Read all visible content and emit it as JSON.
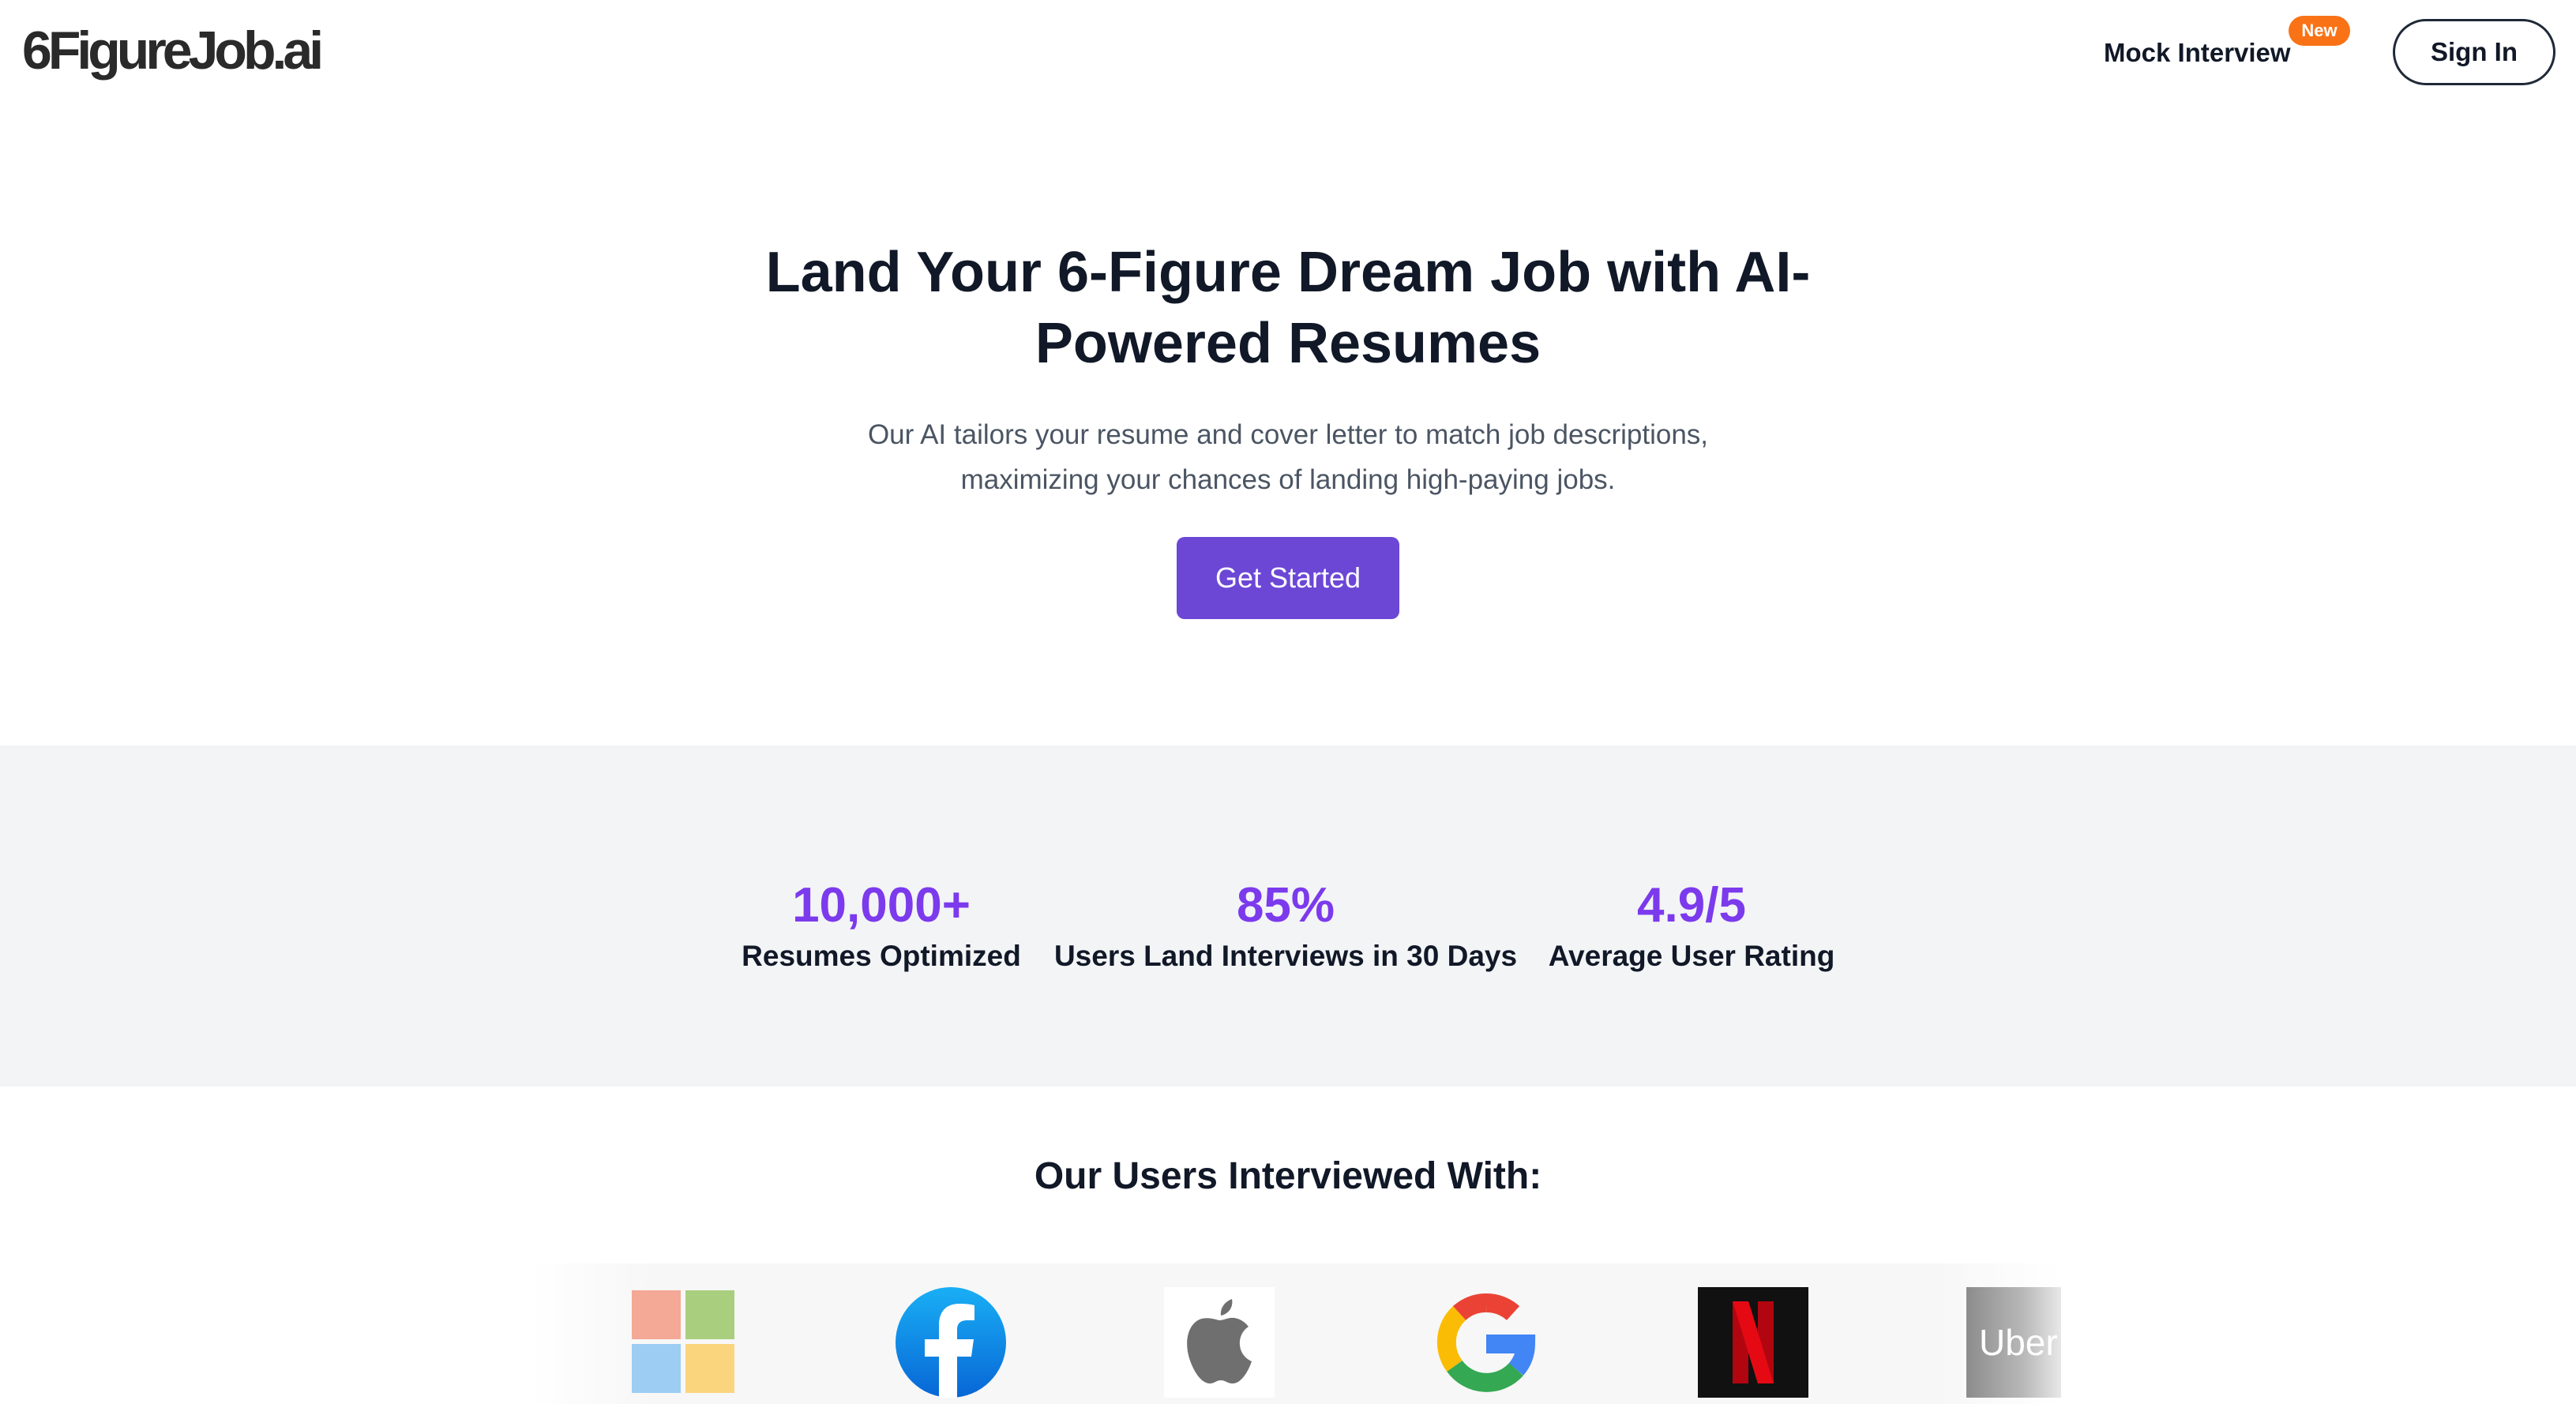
{
  "header": {
    "logo_text": "6FigureJob.ai",
    "nav_mock_interview": "Mock Interview",
    "badge_new": "New",
    "sign_in": "Sign In"
  },
  "hero": {
    "title": "Land Your 6-Figure Dream Job with AI-Powered Resumes",
    "subtitle": "Our AI tailors your resume and cover letter to match job descriptions, maximizing your chances of landing high-paying jobs.",
    "cta": "Get Started"
  },
  "stats": [
    {
      "value": "10,000+",
      "label": "Resumes Optimized"
    },
    {
      "value": "85%",
      "label": "Users Land Interviews in 30 Days"
    },
    {
      "value": "4.9/5",
      "label": "Average User Rating"
    }
  ],
  "companies": {
    "title": "Our Users Interviewed With:",
    "logos": [
      {
        "name": "microsoft",
        "icon": "microsoft-logo-icon"
      },
      {
        "name": "facebook",
        "icon": "facebook-logo-icon"
      },
      {
        "name": "apple",
        "icon": "apple-logo-icon"
      },
      {
        "name": "google",
        "icon": "google-logo-icon"
      },
      {
        "name": "netflix",
        "icon": "netflix-logo-icon"
      },
      {
        "name": "uber",
        "icon": "uber-logo-icon",
        "text": "Uber"
      }
    ]
  },
  "colors": {
    "accent_purple": "#7c3aed",
    "cta_purple": "#6c47d6",
    "badge_orange": "#f97316",
    "stats_bg": "#f3f4f6"
  }
}
